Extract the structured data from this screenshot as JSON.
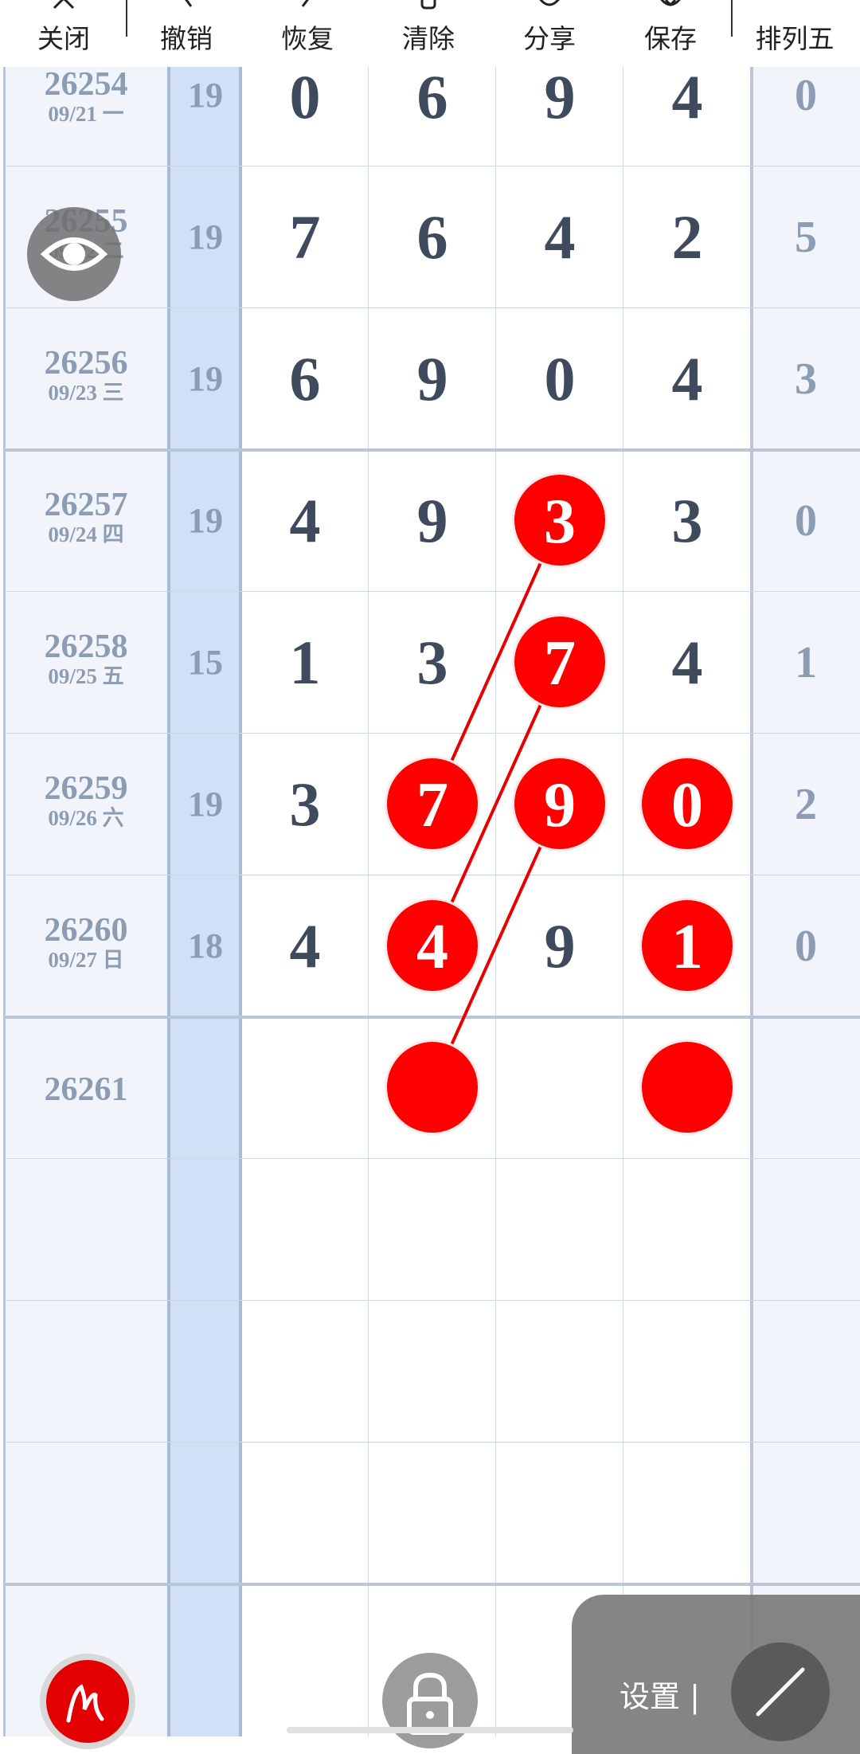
{
  "toolbar": {
    "items": [
      {
        "label": "关闭",
        "icon": "close-icon"
      },
      {
        "label": "撤销",
        "icon": "undo-icon"
      },
      {
        "label": "恢复",
        "icon": "redo-icon"
      },
      {
        "label": "清除",
        "icon": "clear-icon"
      },
      {
        "label": "分享",
        "icon": "share-icon"
      },
      {
        "label": "保存",
        "icon": "save-icon"
      },
      {
        "label": "排列五",
        "icon": "dropdown-icon"
      }
    ]
  },
  "rows": [
    {
      "issue": "26254",
      "date": "09/21 一",
      "sum": "19",
      "digits": [
        "0",
        "6",
        "9",
        "4"
      ],
      "extra": "0"
    },
    {
      "issue": "26255",
      "date": "09/22 二",
      "sum": "19",
      "digits": [
        "7",
        "6",
        "4",
        "2"
      ],
      "extra": "5"
    },
    {
      "issue": "26256",
      "date": "09/23 三",
      "sum": "19",
      "digits": [
        "6",
        "9",
        "0",
        "4"
      ],
      "extra": "3"
    },
    {
      "issue": "26257",
      "date": "09/24 四",
      "sum": "19",
      "digits": [
        "4",
        "9",
        "3",
        "3"
      ],
      "extra": "0"
    },
    {
      "issue": "26258",
      "date": "09/25 五",
      "sum": "15",
      "digits": [
        "1",
        "3",
        "7",
        "4"
      ],
      "extra": "1"
    },
    {
      "issue": "26259",
      "date": "09/26 六",
      "sum": "19",
      "digits": [
        "3",
        "7",
        "9",
        "0"
      ],
      "extra": "2"
    },
    {
      "issue": "26260",
      "date": "09/27 日",
      "sum": "18",
      "digits": [
        "4",
        "4",
        "9",
        "1"
      ],
      "extra": "0"
    },
    {
      "issue": "26261",
      "date": "",
      "sum": "",
      "digits": [
        "",
        "",
        "",
        ""
      ],
      "extra": ""
    }
  ],
  "marks": [
    {
      "row": 3,
      "col": 2,
      "value": "3"
    },
    {
      "row": 4,
      "col": 2,
      "value": "7"
    },
    {
      "row": 5,
      "col": 1,
      "value": "7"
    },
    {
      "row": 5,
      "col": 2,
      "value": "9"
    },
    {
      "row": 5,
      "col": 3,
      "value": "0"
    },
    {
      "row": 6,
      "col": 1,
      "value": "4"
    },
    {
      "row": 6,
      "col": 3,
      "value": "1"
    },
    {
      "row": 7,
      "col": 1,
      "value": ""
    },
    {
      "row": 7,
      "col": 3,
      "value": ""
    }
  ],
  "lines": [
    {
      "from": [
        3,
        2
      ],
      "to": [
        5,
        1
      ]
    },
    {
      "from": [
        4,
        2
      ],
      "to": [
        6,
        1
      ]
    },
    {
      "from": [
        5,
        2
      ],
      "to": [
        7,
        1
      ]
    }
  ],
  "colors": {
    "mark": "#ff0000",
    "line": "#e80000",
    "sum_column": "#cfe0f7",
    "label_column": "#f1f5fb",
    "extra_column": "#f1f5fb"
  },
  "controls": {
    "settings_label": "设置 |",
    "eye_icon": "eye-icon",
    "pen_icon": "pen-icon",
    "lock_icon": "lock-icon",
    "line_tool_icon": "line-tool-icon"
  }
}
